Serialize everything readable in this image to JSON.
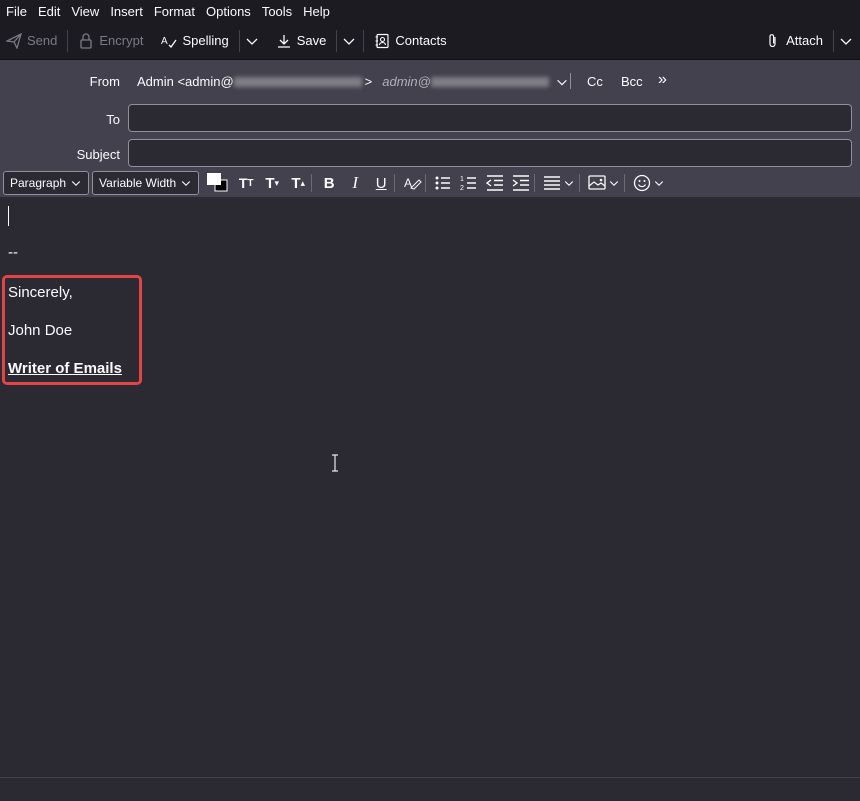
{
  "menubar": {
    "items": [
      {
        "label": "File"
      },
      {
        "label": "Edit"
      },
      {
        "label": "View"
      },
      {
        "label": "Insert"
      },
      {
        "label": "Format"
      },
      {
        "label": "Options"
      },
      {
        "label": "Tools"
      },
      {
        "label": "Help"
      }
    ]
  },
  "toolbar": {
    "send_label": "Send",
    "encrypt_label": "Encrypt",
    "spelling_label": "Spelling",
    "save_label": "Save",
    "contacts_label": "Contacts",
    "attach_label": "Attach"
  },
  "header": {
    "from_label": "From",
    "from_value_prefix": "Admin <admin@",
    "from_value_suffix": ">",
    "from_alias_prefix": "admin@",
    "cc_label": "Cc",
    "bcc_label": "Bcc",
    "more_label": "»",
    "to_label": "To",
    "to_value": "",
    "subject_label": "Subject",
    "subject_value": ""
  },
  "format": {
    "paragraph_label": "Paragraph",
    "font_label": "Variable Width"
  },
  "editor": {
    "sig_separator": "--",
    "sig_line1": "Sincerely,",
    "sig_line2": "John Doe",
    "sig_line3": "Writer of Emails"
  }
}
